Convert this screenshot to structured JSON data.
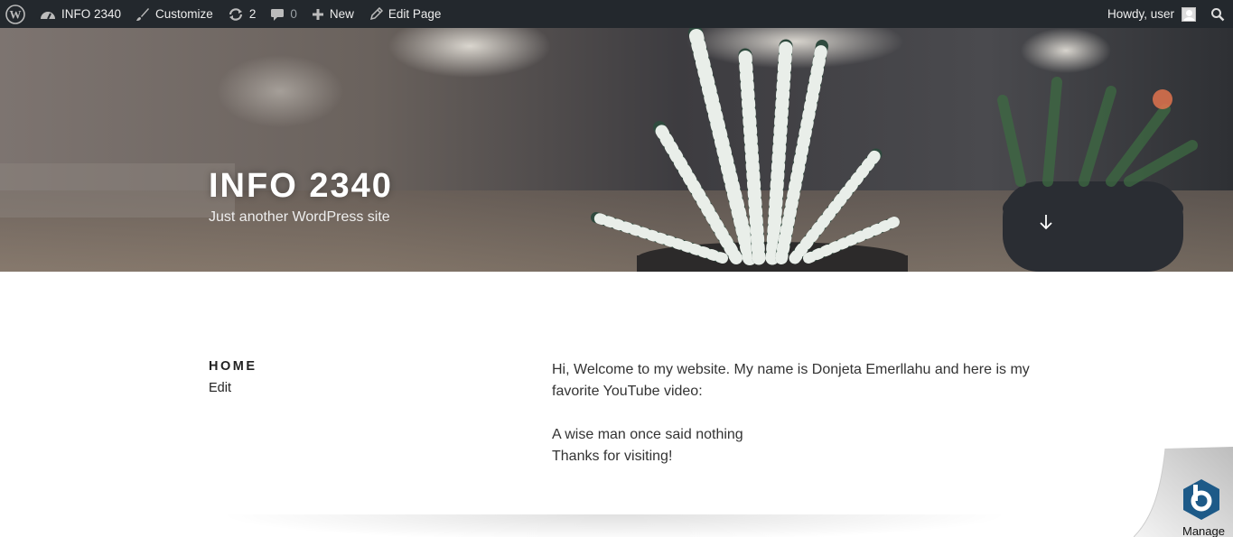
{
  "adminbar": {
    "site_name": "INFO 2340",
    "customize": "Customize",
    "updates_count": "2",
    "comments_count": "0",
    "new": "New",
    "edit_page": "Edit Page",
    "greeting": "Howdy, user"
  },
  "header": {
    "site_title": "INFO 2340",
    "tagline": "Just another WordPress site"
  },
  "page": {
    "title": "HOME",
    "edit_link": "Edit",
    "paragraph1": "Hi, Welcome to my website. My name is Donjeta Emerllahu and here is my favorite YouTube video:",
    "line2": "A wise man once said nothing",
    "line3": "Thanks for visiting!"
  },
  "badge": {
    "label": "Manage"
  },
  "colors": {
    "adminbar_bg": "#23282d",
    "adminbar_text": "#eeeeee",
    "body_text": "#333333",
    "badge_blue": "#1d5a88"
  }
}
